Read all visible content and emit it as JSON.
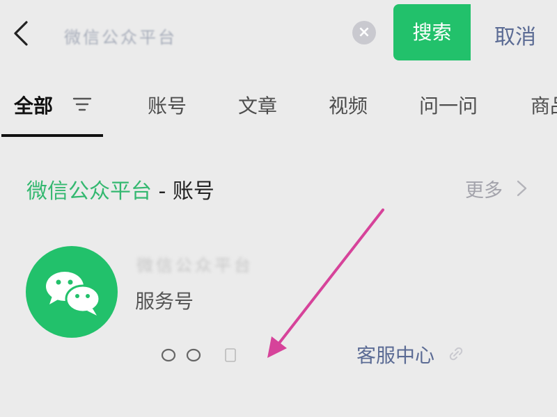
{
  "search": {
    "query": "微信公众平台",
    "clear_icon": "clear-icon",
    "button_label": "搜索",
    "cancel_label": "取消"
  },
  "tabs": [
    {
      "label": "全部",
      "active": true
    },
    {
      "label": "账号"
    },
    {
      "label": "文章"
    },
    {
      "label": "视频"
    },
    {
      "label": "问一问"
    },
    {
      "label": "商品"
    }
  ],
  "section": {
    "title": "微信公众平台",
    "title_suffix": " - 账号",
    "more_label": "更多"
  },
  "account": {
    "name": "微信公众平台",
    "type": "服务号",
    "avatar_icon": "wechat-logo-icon",
    "service_link": "客服中心"
  },
  "colors": {
    "brand_green": "#22c16b",
    "link_blue": "#5b6b94",
    "annotation_arrow": "#d6439a"
  }
}
